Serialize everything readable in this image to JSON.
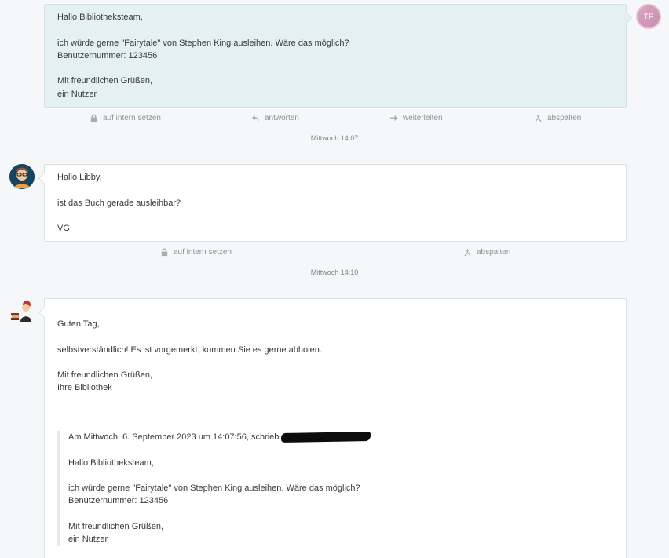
{
  "messages": [
    {
      "sender": "customer",
      "avatar_initials": "TF",
      "text": "Hallo Bibliotheksteam,\n\nich würde gerne \"Fairytale\" von Stephen King ausleihen. Wäre das möglich?\nBenutzernummer: 123456\n\nMit freundlichen Grüßen,\nein Nutzer",
      "actions": {
        "internal": "auf intern setzen",
        "reply": "antworten",
        "forward": "weiterleiten",
        "split": "abspalten"
      },
      "timestamp": "Mittwoch 14:07"
    },
    {
      "sender": "agent",
      "text": "Hallo Libby,\n\nist das Buch gerade ausleihbar?\n\nVG",
      "actions": {
        "internal": "auf intern setzen",
        "split": "abspalten"
      },
      "timestamp": "Mittwoch 14:10"
    },
    {
      "sender": "agent",
      "text": "Guten Tag,\n\nselbstverständlich! Es ist vorgemerkt, kommen Sie es gerne abholen.\n\nMit freundlichen Grüßen,\nIhre Bibliothek",
      "quote": {
        "header": "Am Mittwoch, 6. September 2023 um 14:07:56, schrieb",
        "body": "Hallo Bibliotheksteam,\n\nich würde gerne \"Fairytale\" von Stephen King ausleihen. Wäre das möglich?\nBenutzernummer: 123456\n\nMit freundlichen Grüßen,\nein Nutzer"
      }
    }
  ],
  "icons": {
    "lock": "lock-icon",
    "reply": "reply-icon",
    "forward": "forward-icon",
    "split": "split-icon"
  },
  "colors": {
    "customer_bubble": "#e5f0f3",
    "agent_bubble": "#ffffff",
    "background": "#f6f7f9",
    "avatar_tf": "#d9a6bf"
  }
}
